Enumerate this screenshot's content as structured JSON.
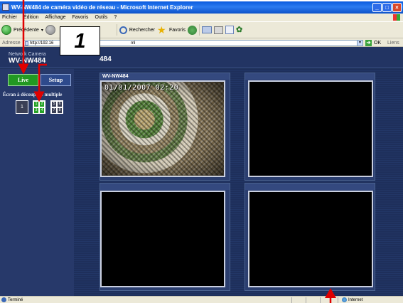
{
  "window": {
    "title": "WV-NW484 de caméra vidéo de réseau - Microsoft Internet Explorer",
    "controls": [
      "_",
      "□",
      "×"
    ]
  },
  "menu": [
    "Fichier",
    "Édition",
    "Affichage",
    "Favoris",
    "Outils",
    "?"
  ],
  "toolbar": {
    "back_label": "Précédente",
    "search_label": "Rechercher",
    "favorites_label": "Favoris"
  },
  "address": {
    "label": "Adresse",
    "value": "http://192.16",
    "value_tail": "ml",
    "go_label": "OK",
    "links_label": "Liens"
  },
  "page": {
    "brand_line": "Network Camera",
    "model": "WV-NW484",
    "header_title": "484",
    "buttons": {
      "live": "Live",
      "setup": "Setup"
    },
    "split_label": "Écran à découpage multiple",
    "split_one": "1",
    "split_quad": [
      "1",
      "2",
      "3",
      "4"
    ],
    "split_eight": [
      "5",
      "6",
      "7",
      "8"
    ],
    "cameras": [
      {
        "name": "WV-NW484",
        "timestamp": "01/01/2007 02:20",
        "has_feed": true
      },
      {
        "name": "",
        "timestamp": "",
        "has_feed": false
      },
      {
        "name": "",
        "timestamp": "",
        "has_feed": false
      },
      {
        "name": "",
        "timestamp": "",
        "has_feed": false
      }
    ]
  },
  "status": {
    "text": "Terminé",
    "zone": "Internet"
  },
  "annotation": {
    "callout_number": "1",
    "colors": {
      "arrow": "#E00000",
      "callout_bg": "#FFFFFF"
    }
  }
}
